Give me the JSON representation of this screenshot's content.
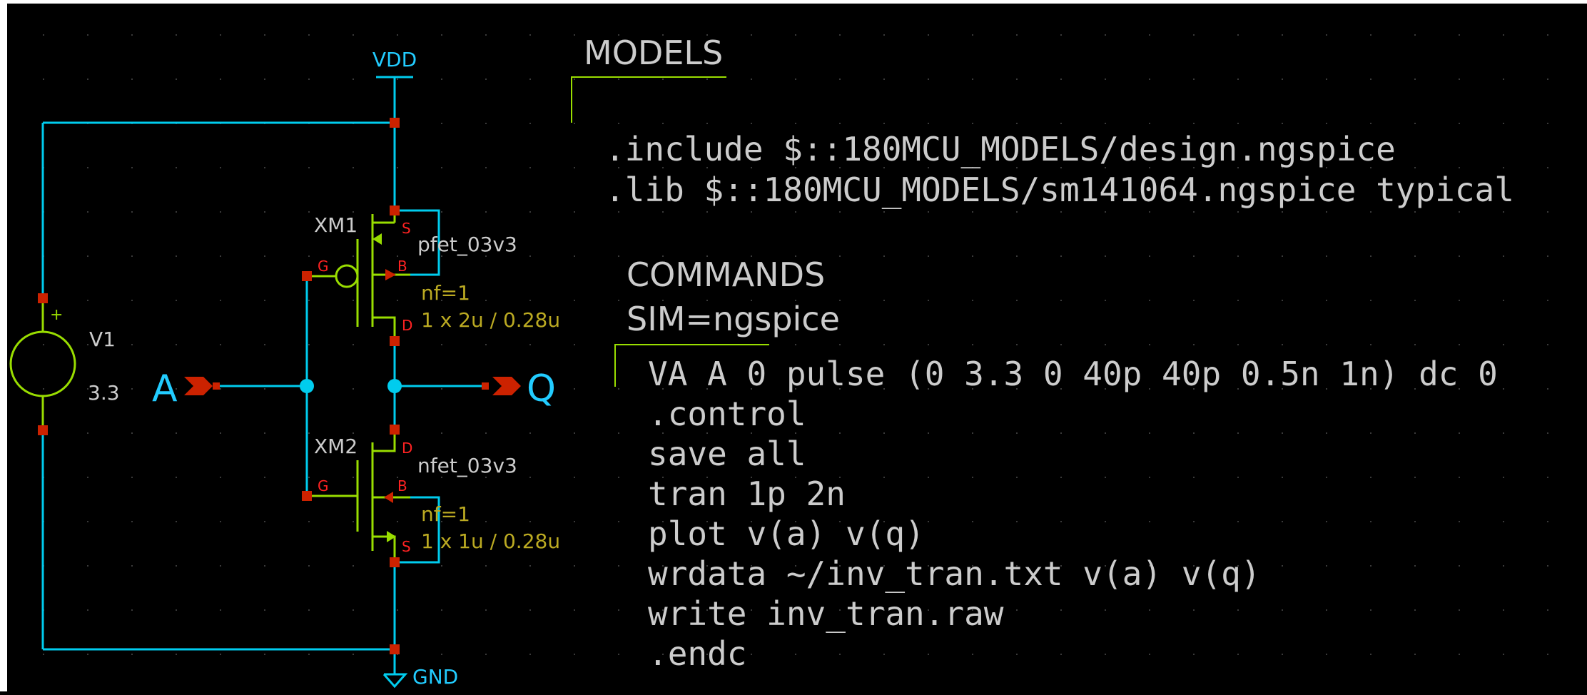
{
  "schematic": {
    "colors": {
      "background": "#000000",
      "wire": "#00ccee",
      "device": "#99dd00",
      "pin": "#cc2200",
      "pin_label": "#ff2222",
      "node_dot": "#00ccee",
      "text": "#cccccc",
      "net_label": "#22ccff",
      "param": "#bbaa22",
      "grid_dot": "#3a3a3a"
    },
    "supply": {
      "vdd_label": "VDD",
      "gnd_label": "GND"
    },
    "source": {
      "name": "V1",
      "value": "3.3",
      "plus": "+"
    },
    "ports": {
      "input": "A",
      "output": "Q"
    },
    "pmos": {
      "instance": "XM1",
      "model": "pfet_03v3",
      "nf": "nf=1",
      "size": "1 x 2u / 0.28u",
      "pins": {
        "s": "S",
        "g": "G",
        "b": "B",
        "d": "D"
      }
    },
    "nmos": {
      "instance": "XM2",
      "model": "nfet_03v3",
      "nf": "nf=1",
      "size": "1 x 1u / 0.28u",
      "pins": {
        "d": "D",
        "g": "G",
        "b": "B",
        "s": "S"
      }
    }
  },
  "models_block": {
    "title": "MODELS",
    "lines": [
      ".include $::180MCU_MODELS/design.ngspice",
      ".lib $::180MCU_MODELS/sm141064.ngspice typical"
    ]
  },
  "commands_block": {
    "title": "COMMANDS",
    "sim": "SIM=ngspice",
    "lines": [
      "VA A 0 pulse (0 3.3 0 40p 40p 0.5n 1n) dc 0",
      ".control",
      "save all",
      "tran 1p 2n",
      "plot v(a) v(q)",
      "wrdata ~/inv_tran.txt v(a) v(q)",
      "write inv_tran.raw",
      ".endc"
    ]
  }
}
